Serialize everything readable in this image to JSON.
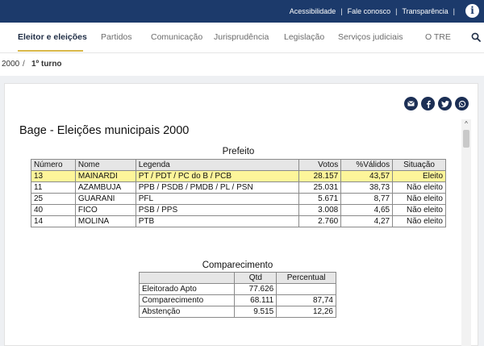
{
  "topbar": {
    "links": [
      "Acessibilidade",
      "Fale conosco",
      "Transparência"
    ],
    "separator": "|",
    "info_icon": "info-icon"
  },
  "nav": {
    "items": [
      {
        "label": "Eleitor e eleições",
        "active": true
      },
      {
        "label": "Partidos"
      },
      {
        "label": "Comunicação"
      },
      {
        "label": "Jurisprudência"
      },
      {
        "label": "Legislação"
      },
      {
        "label": "Serviços judiciais"
      },
      {
        "label": "O TRE"
      }
    ],
    "search_icon": "search-icon",
    "accent": "#d9b84a"
  },
  "breadcrumb": {
    "items": [
      "2000",
      "1º turno"
    ],
    "separator": "/"
  },
  "share": {
    "icons": [
      "email-icon",
      "facebook-icon",
      "twitter-icon",
      "whatsapp-icon"
    ]
  },
  "report": {
    "title": "Bage - Eleições municipais 2000",
    "prefeito": {
      "caption": "Prefeito",
      "headers": [
        "Número",
        "Nome",
        "Legenda",
        "Votos",
        "%Válidos",
        "Situação"
      ],
      "rows": [
        {
          "numero": "13",
          "nome": "MAINARDI",
          "legenda": "PT / PDT / PC do B / PCB",
          "votos": "28.157",
          "validos": "43,57",
          "situacao": "Eleito",
          "highlight": true
        },
        {
          "numero": "11",
          "nome": "AZAMBUJA",
          "legenda": "PPB / PSDB / PMDB / PL / PSN",
          "votos": "25.031",
          "validos": "38,73",
          "situacao": "Não eleito"
        },
        {
          "numero": "25",
          "nome": "GUARANI",
          "legenda": "PFL",
          "votos": "5.671",
          "validos": "8,77",
          "situacao": "Não eleito"
        },
        {
          "numero": "40",
          "nome": "FICO",
          "legenda": "PSB / PPS",
          "votos": "3.008",
          "validos": "4,65",
          "situacao": "Não eleito"
        },
        {
          "numero": "14",
          "nome": "MOLINA",
          "legenda": "PTB",
          "votos": "2.760",
          "validos": "4,27",
          "situacao": "Não eleito"
        }
      ],
      "highlight_color": "#fdf59a"
    },
    "comparecimento": {
      "caption": "Comparecimento",
      "headers": [
        "",
        "Qtd",
        "Percentual"
      ],
      "rows": [
        {
          "label": "Eleitorado Apto",
          "qtd": "77.626",
          "pct": ""
        },
        {
          "label": "Comparecimento",
          "qtd": "68.111",
          "pct": "87,74"
        },
        {
          "label": "Abstenção",
          "qtd": "9.515",
          "pct": "12,26"
        }
      ]
    }
  },
  "colors": {
    "topbar": "#1c3a6b",
    "share_button": "#1c2f55",
    "page_bg": "#eef0f3"
  }
}
